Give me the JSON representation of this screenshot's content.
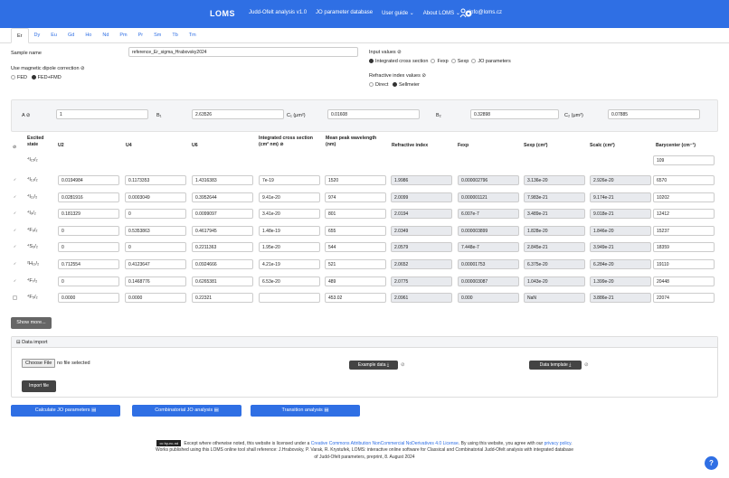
{
  "nav": {
    "brand": "LOMS",
    "links": [
      "Judd-Ofelt analysis v1.0",
      "JO parameter database",
      "User guide ⌄",
      "About LOMS ⌄",
      "info@loms.cz"
    ]
  },
  "tabs": [
    "Er",
    "Dy",
    "Eu",
    "Gd",
    "Ho",
    "Nd",
    "Pm",
    "Pr",
    "Sm",
    "Tb",
    "Tm"
  ],
  "form": {
    "sample_label": "Sample name",
    "sample_value": "reference_Er_sigma_Hrabovsky2024",
    "mdc_label": "Use magnetic dipole correction ⊘",
    "mdc_opt1": "FED",
    "mdc_opt2": "FED+FMD",
    "input_label": "Input values ⊘",
    "input_opt1": "Integrated cross section",
    "input_opt2": "Fexp",
    "input_opt3": "Sexp",
    "input_opt4": "JO parameters",
    "ri_label": "Refractive index values ⊘",
    "ri_opt1": "Direct",
    "ri_opt2": "Sellmeier"
  },
  "sellmeier": {
    "A_label": "A ⊘",
    "A": "1",
    "B1_label": "B₁",
    "B1": "2.63526",
    "C1_label": "C₁ (μm²)",
    "C1": "0.01608",
    "B2_label": "B₂",
    "B2": "0.32898",
    "C2_label": "C₂ (μm²)",
    "C2": "0.07885"
  },
  "table": {
    "headers": [
      "Excited state",
      "U2",
      "U4",
      "U6",
      "Integrated cross section (cm² nm) ⊘",
      "Mean peak wavelength (nm)",
      "Refractive index",
      "Fexp",
      "Sexp (cm²)",
      "Scalc (cm²)",
      "Barycenter (cm⁻¹)"
    ],
    "ground": {
      "state": "⁴I₁₅/₂",
      "bary": "109"
    },
    "rows": [
      {
        "state": "⁴I₁₃/₂",
        "u2": "0.0194984",
        "u4": "0.1173353",
        "u6": "1.4316383",
        "ics": "7e-19",
        "wl": "1520",
        "n": "1.9986",
        "fexp": "0.000002796",
        "sexp": "3.136e-20",
        "scalc": "2.926e-20",
        "bary": "6570"
      },
      {
        "state": "⁴I₁₁/₂",
        "u2": "0.0281916",
        "u4": "0.0003049",
        "u6": "0.3952644",
        "ics": "9.41e-20",
        "wl": "974",
        "n": "2.0099",
        "fexp": "0.000001121",
        "sexp": "7.983e-21",
        "scalc": "9.174e-21",
        "bary": "10202"
      },
      {
        "state": "⁴I₉/₂",
        "u2": "0.181329",
        "u4": "0",
        "u6": "0.0099097",
        "ics": "3.41e-20",
        "wl": "801",
        "n": "2.0194",
        "fexp": "6.007e-7",
        "sexp": "3.489e-21",
        "scalc": "9.018e-21",
        "bary": "12412"
      },
      {
        "state": "⁴F₉/₂",
        "u2": "0",
        "u4": "0.5353863",
        "u6": "0.4617945",
        "ics": "1.48e-19",
        "wl": "655",
        "n": "2.0349",
        "fexp": "0.000003899",
        "sexp": "1.828e-20",
        "scalc": "1.846e-20",
        "bary": "15237"
      },
      {
        "state": "⁴S₃/₂",
        "u2": "0",
        "u4": "0",
        "u6": "0.2211363",
        "ics": "1.95e-20",
        "wl": "544",
        "n": "2.0579",
        "fexp": "7.448e-7",
        "sexp": "2.845e-21",
        "scalc": "3.949e-21",
        "bary": "18359"
      },
      {
        "state": "²H₁₁/₂",
        "u2": "0.712554",
        "u4": "0.4123647",
        "u6": "0.0924666",
        "ics": "4.21e-19",
        "wl": "521",
        "n": "2.0652",
        "fexp": "0.00001753",
        "sexp": "6.375e-20",
        "scalc": "6.284e-20",
        "bary": "19110"
      },
      {
        "state": "⁴F₇/₂",
        "u2": "0",
        "u4": "0.1468776",
        "u6": "0.6265381",
        "ics": "6.53e-20",
        "wl": "489",
        "n": "2.0775",
        "fexp": "0.000003087",
        "sexp": "1.043e-20",
        "scalc": "1.399e-20",
        "bary": "20448"
      },
      {
        "state": "⁴F₅/₂",
        "u2": "0.0000",
        "u4": "0.0000",
        "u6": "0.22321",
        "ics": "",
        "wl": "453.02",
        "n": "2.0961",
        "fexp": "0.000",
        "sexp": "NaN",
        "scalc": "3.886e-21",
        "bary": "22074"
      }
    ]
  },
  "show_more": "Show more...",
  "import": {
    "title": "⊟ Data import",
    "choose": "Choose File",
    "nofile": "no file selected",
    "example": "Example data ⤓",
    "template": "Data template ⤓",
    "import_btn": "Import file"
  },
  "actions": [
    "Calculate JO parameters ▤",
    "Combinatorial JO analysis ▤",
    "Transition analysis ▤"
  ],
  "footer": {
    "line1a": "Except where otherwise noted, this website is licensed under a ",
    "line1link": "Creative Commons Attribution NonCommercial NoDerivatives 4.0 License",
    "line1b": ". By using this website, you agree with our ",
    "line1link2": "privacy policy",
    "line2": "Works published using this LOMS online tool shall reference: J.Hrabovsky, P. Varak, R. Krystufek, LOMS: interactive online software for Classical and Combinatorial Judd-Ofelt analysis with integrated database",
    "line3": "of Judd-Ofelt parameters, preprint, 8. August 2024",
    "cc": "cc by-nc-nd"
  },
  "help": "?"
}
